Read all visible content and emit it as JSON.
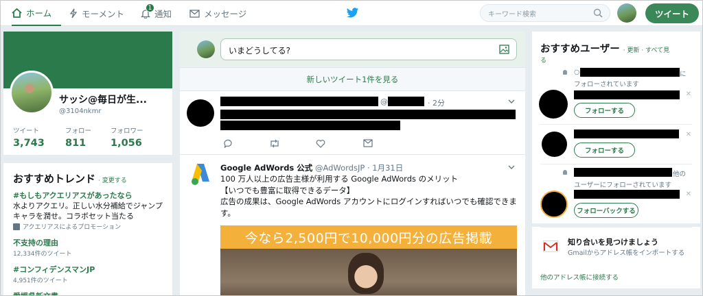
{
  "nav": {
    "home": "ホーム",
    "moments": "モーメント",
    "notifications": "通知",
    "notif_count": "1",
    "messages": "メッセージ",
    "search_placeholder": "キーワード検索",
    "tweet_button": "ツイート"
  },
  "profile": {
    "name": "サッシ@毎日が生...",
    "handle": "@3104nkmr",
    "stats": [
      {
        "label": "ツイート",
        "value": "3,743"
      },
      {
        "label": "フォロー",
        "value": "811"
      },
      {
        "label": "フォロワー",
        "value": "1,056"
      }
    ]
  },
  "trends": {
    "title": "おすすめトレンド",
    "change": "· 変更する",
    "items": [
      {
        "tag": "#もしもアクエリアスがあったなら",
        "desc": "水よりアクエリ。正しい水分補給でジャンプキャラを潤せ。コラボセット当たる",
        "promo": "アクエリアスによるプロモーション"
      },
      {
        "tag": "不支持の理由",
        "count": "12,334件のツイート"
      },
      {
        "tag": "#コンフィデンスマンJP",
        "count": "4,951件のツイート"
      },
      {
        "tag": "愛媛県新文書",
        "count": ""
      }
    ]
  },
  "compose": {
    "placeholder": "いまどうしてる?"
  },
  "timeline": {
    "new_tweets": "新しいツイート1件を見る",
    "tweet1": {
      "at": "@",
      "time": "· 2分"
    },
    "ad": {
      "name": "Google AdWords 公式",
      "handle": "@AdWordsJP",
      "date": "· 1月31日",
      "lines": [
        "100 万人以上の広告主様が利用する Google AdWords のメリット",
        "【いつでも豊富に取得できるデータ】",
        "広告の成果は、Google AdWords アカウントにログインすればいつでも確認できます。"
      ],
      "banner": "今なら2,500円で10,000円分の広告掲載"
    }
  },
  "who_to_follow": {
    "title": "おすすめユーザー",
    "refresh": "· 更新 · すべて見",
    "refresh2": "る",
    "users": [
      {
        "context_prefix": "○",
        "context_suffix": "に",
        "context_line2": "フォローされています",
        "button": "フォローする"
      },
      {
        "button": "フォローする"
      },
      {
        "context_suffix": "他の",
        "context_line2": "ユーザーにフォローされています",
        "button": "フォローバックする"
      }
    ]
  },
  "gmail": {
    "title": "知り合いを見つけましょう",
    "subtitle": "Gmailからアドレス帳をインポートする",
    "link": "他のアドレス帳に接続する"
  },
  "colors": {
    "accent": "#2b7a4b",
    "tweet_button": "#3a8757",
    "ad_banner": "#f3b13c",
    "twitter_bird": "#1da1f2"
  }
}
